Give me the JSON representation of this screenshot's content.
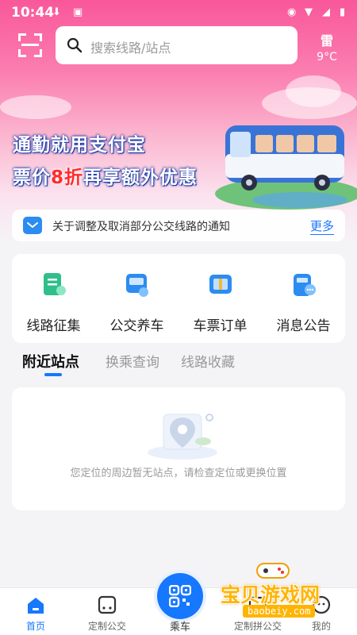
{
  "status_bar": {
    "time": "10:44"
  },
  "search": {
    "placeholder": "搜索线路/站点"
  },
  "weather": {
    "icon": "雷",
    "temp": "9°C"
  },
  "banner": {
    "line1": "通勤就用支付宝",
    "line2_pre": "票价",
    "line2_highlight": "8折",
    "line2_post": "再享额外优惠"
  },
  "notice": {
    "text": "关于调整及取消部分公交线路的通知",
    "more": "更多"
  },
  "services": [
    {
      "label": "线路征集",
      "icon": "route-collect-icon"
    },
    {
      "label": "公交养车",
      "icon": "bus-maintenance-icon"
    },
    {
      "label": "车票订单",
      "icon": "ticket-order-icon"
    },
    {
      "label": "消息公告",
      "icon": "message-notice-icon"
    }
  ],
  "tabs": [
    {
      "label": "附近站点",
      "active": true
    },
    {
      "label": "换乘查询",
      "active": false
    },
    {
      "label": "线路收藏",
      "active": false
    }
  ],
  "nearby": {
    "empty_text": "您定位的周边暂无站点，请检查定位或更换位置"
  },
  "bottom_nav": [
    {
      "label": "首页",
      "icon": "home-icon",
      "active": true
    },
    {
      "label": "定制公交",
      "icon": "custom-bus-icon",
      "active": false
    },
    {
      "label": "乘车",
      "icon": "qr-code-icon",
      "active": false
    },
    {
      "label": "定制拼公交",
      "icon": "shared-bus-icon",
      "active": false
    },
    {
      "label": "我的",
      "icon": "profile-icon",
      "active": false
    }
  ],
  "watermark": {
    "title": "宝贝游戏网",
    "url": "baobeiy.com"
  },
  "colors": {
    "accent": "#1677ff",
    "hero_pink": "#f9579a",
    "highlight_red": "#ff2b2b"
  }
}
